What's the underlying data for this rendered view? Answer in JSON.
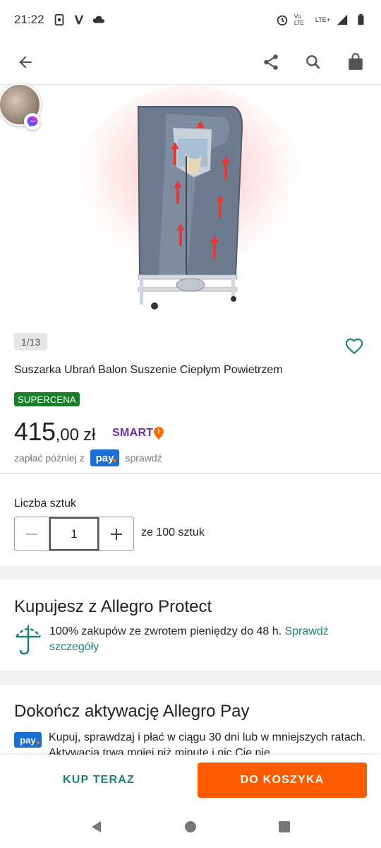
{
  "status_bar": {
    "time": "21:22",
    "network": "LTE+",
    "volte": "Vo LTE",
    "icons": [
      "data-saver-icon",
      "app-v-icon",
      "cloud-icon",
      "alarm-icon",
      "signal-icon",
      "battery-icon"
    ]
  },
  "app_bar": {
    "icons": [
      "back-arrow-icon",
      "share-icon",
      "search-icon",
      "shopping-bag-icon"
    ]
  },
  "gallery": {
    "counter": "1/13",
    "image_alt": "clothes dryer wardrobe"
  },
  "product": {
    "title": "Suszarka Ubrań Balon Suszenie Ciepłym Powietrzem",
    "badge": "SUPERCENA",
    "price_int": "415",
    "price_frac": ",00",
    "currency": "zł",
    "smart_label": "SMART",
    "pay_later_prefix": "zapłać później z",
    "pay_label": "pay",
    "pay_later_suffix": "sprawdź"
  },
  "quantity": {
    "label": "Liczba sztuk",
    "value": "1",
    "of_label": "ze 100 sztuk"
  },
  "protect": {
    "title": "Kupujesz z Allegro Protect",
    "text": "100% zakupów ze zwrotem pieniędzy do 48 h.",
    "link": "Sprawdź szczegóły"
  },
  "allegro_pay": {
    "title": "Dokończ aktywację Allegro Pay",
    "pay_label": "pay",
    "text": "Kupuj, sprawdzaj i płać w ciągu 30 dni lub w mniejszych ratach. Aktywacja trwa mniej niż minutę i nic Cię nie"
  },
  "actions": {
    "buy_now": "KUP TERAZ",
    "add_to_cart": "DO KOSZYKA"
  },
  "colors": {
    "accent_teal": "#17837a",
    "cart_orange": "#ff5a00",
    "badge_green": "#1a7d2a",
    "pay_blue": "#1b6fd2",
    "smart_purple": "#6b2fa0"
  }
}
